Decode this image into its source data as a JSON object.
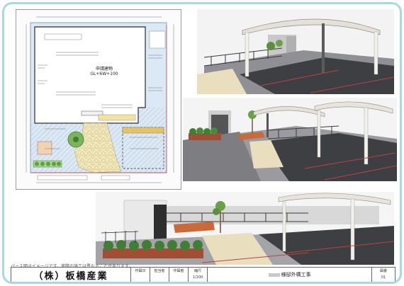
{
  "note": "パース図はイメージです。実際の施工は異なることがあります。",
  "titleblock": {
    "company": "（株）板橋産業",
    "cells": [
      "作図日",
      "担当者",
      "作図者",
      "縮尺"
    ],
    "scale": "1/100",
    "project": "様邸外構工事",
    "drawing_no_label": "図番",
    "drawing_no": "01"
  },
  "plan": {
    "building_label": "申請建物",
    "building_sub": "GL+6W+100"
  },
  "colors": {
    "frame": "#a9d8e0",
    "pavement": "#8f8f95",
    "dark_floor": "#3d3f43",
    "gravel": "#e9dfbf",
    "fence": "#3a3a3a",
    "deck": "#c96a3a",
    "planter": "#a24e34",
    "shrub": "#3f7f35"
  }
}
